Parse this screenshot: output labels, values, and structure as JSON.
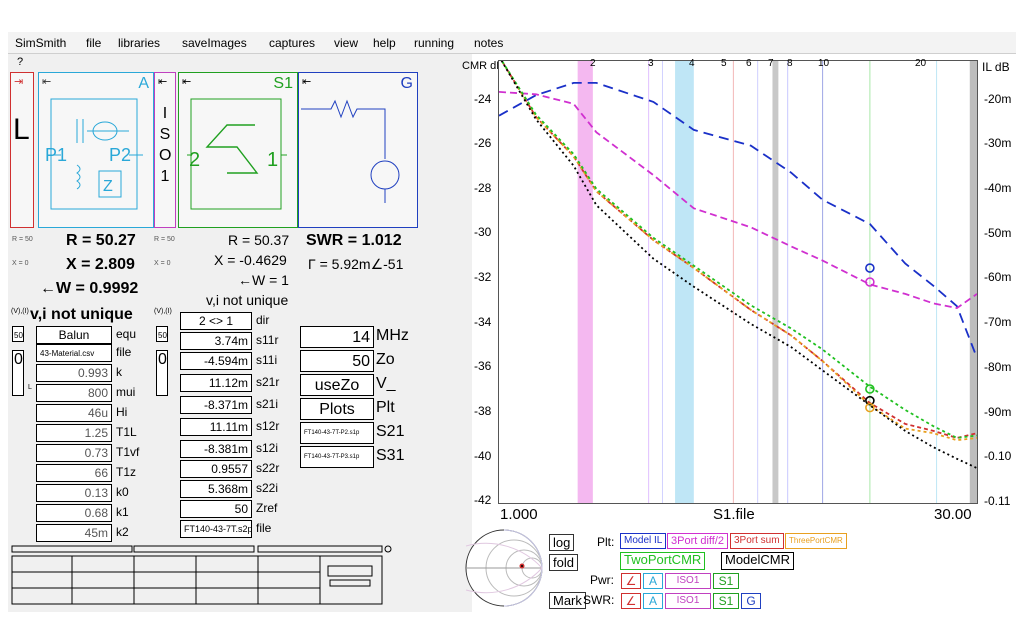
{
  "menu": [
    "SimSmith",
    "file",
    "libraries",
    "saveImages",
    "captures",
    "view",
    "help",
    "running",
    "notes"
  ],
  "question_mark": "?",
  "blocks": {
    "L": {
      "label": "L",
      "color": "#d03030"
    },
    "A": {
      "label": "A",
      "color": "#2aa8d8",
      "port1": "P1",
      "port2": "P2"
    },
    "ISO": {
      "letters": [
        "I",
        "S",
        "O",
        "1"
      ],
      "color": "#c040c0"
    },
    "S1": {
      "label": "S1",
      "color": "#20a020",
      "port2": "2",
      "port1": "1"
    },
    "G": {
      "label": "G",
      "color": "#2040c0"
    }
  },
  "readout": {
    "r_tag": "R = 50",
    "x_tag": "X = 0",
    "R": "R = 50.27",
    "X": "X = 2.809",
    "W": "←W = 0.9992",
    "vi": "v,i not unique",
    "R2": "R = 50.37",
    "X2": "X = -0.4629",
    "W2": "←W = 1",
    "vi2": "v,i not unique",
    "SWR": "SWR = 1.012",
    "gamma": "Γ = 5.92m∠-51",
    "r_tag2": "R = 50",
    "x_tag2": "X = 0",
    "vi_tag": "(V),(I)",
    "vi_tag2": "(V),(I)"
  },
  "balun": {
    "fields": [
      {
        "value": "Balun",
        "label": "equ"
      },
      {
        "value": "43-Material.csv",
        "label": "file"
      },
      {
        "value": "0.993",
        "label": "k"
      },
      {
        "value": "800",
        "label": "mui"
      },
      {
        "value": "46u",
        "label": "Hi"
      },
      {
        "value": "1.25",
        "label": "T1L"
      },
      {
        "value": "0.73",
        "label": "T1vf"
      },
      {
        "value": "66",
        "label": "T1z"
      },
      {
        "value": "0.13",
        "label": "k0"
      },
      {
        "value": "0.68",
        "label": "k1"
      },
      {
        "value": "45m",
        "label": "k2"
      }
    ],
    "side_top": "50",
    "side_mid": "0",
    "side_ind": "L"
  },
  "sparam": {
    "fields": [
      {
        "value": "2 <> 1",
        "label": "dir"
      },
      {
        "value": "3.74m",
        "label": "s11r"
      },
      {
        "value": "-4.594m",
        "label": "s11i"
      },
      {
        "value": "11.12m",
        "label": "s21r"
      },
      {
        "value": "-8.371m",
        "label": "s21i"
      },
      {
        "value": "11.11m",
        "label": "s12r"
      },
      {
        "value": "-8.381m",
        "label": "s12i"
      },
      {
        "value": "0.9557",
        "label": "s22r"
      },
      {
        "value": "5.368m",
        "label": "s22i"
      },
      {
        "value": "50",
        "label": "Zref"
      },
      {
        "value": "FT140-43-7T.s2p",
        "label": "file"
      }
    ],
    "side_top": "50",
    "side_mid": "0"
  },
  "controls": {
    "fields": [
      {
        "value": "14",
        "label": "MHz"
      },
      {
        "value": "50",
        "label": "Zo"
      },
      {
        "value": "useZo",
        "label": "V_"
      },
      {
        "value": "Plots",
        "label": "Plt"
      },
      {
        "value": "FT140-43-7T-P2.s1p",
        "label": "S21"
      },
      {
        "value": "FT140-43-7T-P3.s1p",
        "label": "S31"
      }
    ]
  },
  "plot": {
    "left_axis_title": "CMR dB",
    "right_axis_title": "IL dB",
    "x_start": "1.000",
    "x_end": "30.00",
    "x_center": "S1.file",
    "left_ticks": [
      "-24",
      "-26",
      "-28",
      "-30",
      "-32",
      "-34",
      "-36",
      "-38",
      "-40",
      "-42"
    ],
    "right_ticks": [
      "-20m",
      "-30m",
      "-40m",
      "-50m",
      "-60m",
      "-70m",
      "-80m",
      "-90m",
      "-0.10",
      "-0.11"
    ],
    "top_ticks": [
      "2",
      "3",
      "4",
      "5",
      "6",
      "7",
      "8",
      "10",
      "20"
    ]
  },
  "chart_data": {
    "type": "line",
    "title": "",
    "xlabel": "S1.file",
    "x_scale": "log",
    "xlim": [
      1,
      30
    ],
    "ylim_left": [
      -42,
      -23
    ],
    "ylim_right": [
      -0.11,
      -0.017
    ],
    "left_ylabel": "CMR dB",
    "right_ylabel": "IL dB",
    "series": [
      {
        "name": "Model IL",
        "color": "#1a30c8",
        "dash": "10,6",
        "axis": "right",
        "x": [
          1.0,
          1.3,
          1.7,
          2.0,
          3.0,
          4.0,
          6.0,
          8.0,
          10.0,
          14.0,
          18.0,
          22.0,
          26.0,
          30.0
        ],
        "y": [
          -0.0285,
          -0.0242,
          -0.0216,
          -0.0216,
          -0.0256,
          -0.0315,
          -0.0348,
          -0.0405,
          -0.0462,
          -0.0513,
          -0.0596,
          -0.0643,
          -0.0686,
          -0.0795
        ]
      },
      {
        "name": "3Port diff/2",
        "color": "#d030d0",
        "dash": "7,4",
        "axis": "right",
        "x": [
          1.0,
          1.3,
          1.7,
          2.0,
          3.0,
          4.0,
          6.0,
          8.0,
          10.0,
          14.0,
          18.0,
          22.0,
          26.0,
          30.0
        ],
        "y": [
          -0.0235,
          -0.024,
          -0.026,
          -0.032,
          -0.041,
          -0.048,
          -0.052,
          -0.056,
          -0.059,
          -0.064,
          -0.066,
          -0.068,
          -0.069,
          -0.066
        ]
      },
      {
        "name": "3Port sum",
        "color": "#d03030",
        "dash": "4,3",
        "axis": "left",
        "x": [
          1.0,
          1.3,
          1.7,
          2.0,
          3.0,
          4.0,
          6.0,
          8.0,
          10.0,
          14.0,
          18.0,
          22.0,
          26.0,
          30.0
        ],
        "y": [
          -22.8,
          -25.4,
          -27.1,
          -28.6,
          -30.7,
          -31.9,
          -33.7,
          -34.8,
          -35.9,
          -37.7,
          -38.6,
          -38.9,
          -39.2,
          -39.0
        ]
      },
      {
        "name": "ThreePortCMR",
        "color": "#e8a020",
        "dash": "3,3",
        "axis": "left",
        "x": [
          1.0,
          1.3,
          1.7,
          2.0,
          3.0,
          4.0,
          6.0,
          8.0,
          10.0,
          14.0,
          18.0,
          22.0,
          26.0,
          30.0
        ],
        "y": [
          -22.8,
          -25.4,
          -27.1,
          -28.6,
          -30.7,
          -31.9,
          -33.7,
          -34.8,
          -35.9,
          -37.8,
          -38.8,
          -39.0,
          -39.3,
          -39.2
        ]
      },
      {
        "name": "TwoPortCMR",
        "color": "#20c020",
        "dash": "3,3",
        "axis": "left",
        "x": [
          1.0,
          1.3,
          1.7,
          2.0,
          3.0,
          4.0,
          6.0,
          8.0,
          10.0,
          14.0,
          18.0,
          22.0,
          26.0,
          30.0
        ],
        "y": [
          -22.8,
          -25.3,
          -27.0,
          -28.5,
          -30.6,
          -31.8,
          -33.5,
          -34.5,
          -35.4,
          -37.0,
          -38.0,
          -38.7,
          -39.2,
          -39.1
        ]
      },
      {
        "name": "ModelCMR",
        "color": "#000000",
        "dash": "2,3",
        "axis": "left",
        "x": [
          1.0,
          1.3,
          1.7,
          2.0,
          3.0,
          4.0,
          6.0,
          8.0,
          10.0,
          14.0,
          18.0,
          22.0,
          26.0,
          30.0
        ],
        "y": [
          -22.8,
          -25.5,
          -27.5,
          -29.2,
          -31.5,
          -32.7,
          -34.3,
          -35.3,
          -36.3,
          -37.8,
          -38.9,
          -39.6,
          -40.1,
          -40.5
        ]
      }
    ],
    "bands": [
      {
        "x_from": 1.75,
        "x_to": 1.95,
        "color": "#f4b8f0"
      },
      {
        "x_from": 3.5,
        "x_to": 4.0,
        "color": "#bfe6f6"
      },
      {
        "x_from": 7.0,
        "x_to": 7.3,
        "color": "#c8c8c8"
      },
      {
        "x_from": 28.5,
        "x_to": 30.0,
        "color": "#bdbdbd"
      }
    ],
    "vlines": [
      {
        "x": 2.9,
        "color": "#e0c0ff"
      },
      {
        "x": 3.2,
        "color": "#d0d0ff"
      },
      {
        "x": 5.3,
        "color": "#f2b8b8"
      },
      {
        "x": 6.3,
        "color": "#cfcfff"
      },
      {
        "x": 7.8,
        "color": "#c8c8ff"
      },
      {
        "x": 10.0,
        "color": "#9fa6e6"
      },
      {
        "x": 14.0,
        "color": "#a8e8a8"
      },
      {
        "x": 22.5,
        "color": "#bfe6f6"
      }
    ],
    "markers": [
      {
        "x": 14.0,
        "y": -31.9,
        "color": "#1a30c8"
      },
      {
        "x": 14.0,
        "y": -32.5,
        "color": "#d030d0"
      },
      {
        "x": 14.0,
        "y": -37.1,
        "color": "#20c020"
      },
      {
        "x": 14.0,
        "y": -37.6,
        "color": "#000000"
      },
      {
        "x": 14.0,
        "y": -37.9,
        "color": "#e8a020"
      }
    ]
  },
  "legend": {
    "plt_label": "Plt:",
    "items": [
      {
        "label": "Model IL",
        "color": "#1a30c8"
      },
      {
        "label": "3Port diff/2",
        "color": "#d030d0"
      },
      {
        "label": "3Port sum",
        "color": "#d03030"
      },
      {
        "label": "ThreePortCMR",
        "color": "#e8a020"
      }
    ],
    "row2": [
      {
        "label": "TwoPortCMR",
        "color": "#20c020"
      },
      {
        "label": "ModelCMR",
        "color": "#000000"
      }
    ]
  },
  "smith": {
    "log": "log",
    "fold": "fold",
    "mark": "Mark",
    "pwr": "Pwr:",
    "swr": "SWR:"
  }
}
